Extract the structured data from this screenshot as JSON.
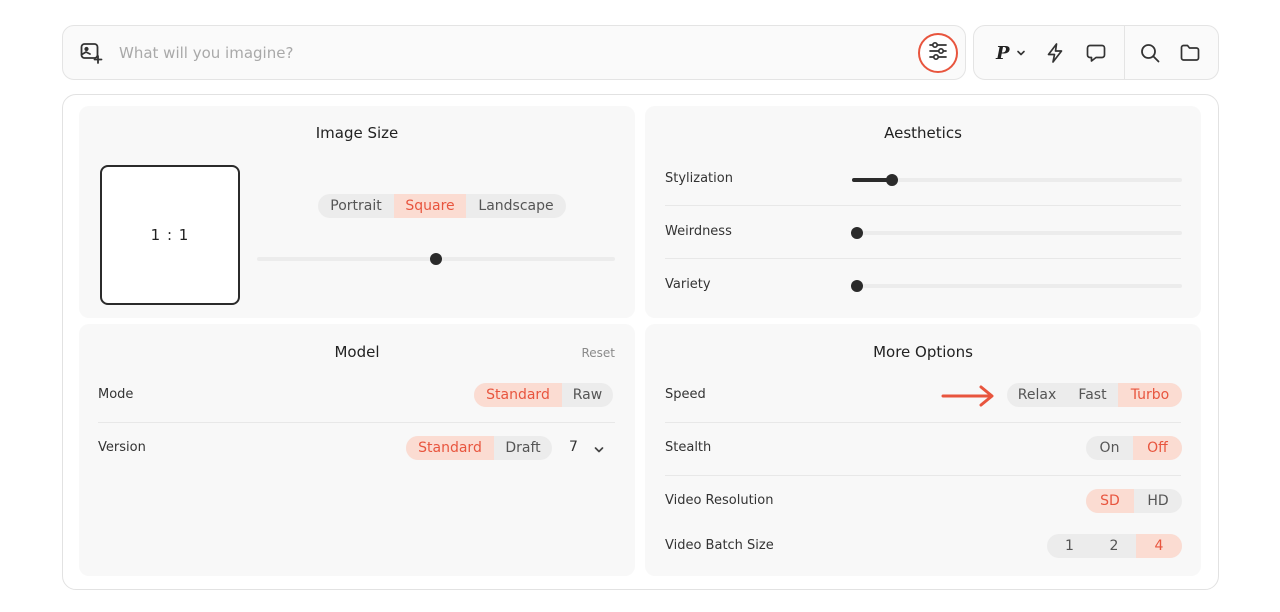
{
  "prompt": {
    "placeholder": "What will you imagine?"
  },
  "toolbar": {
    "personalize_label": "P"
  },
  "image_size": {
    "title": "Image Size",
    "ratio": "1 : 1",
    "orientations": [
      "Portrait",
      "Square",
      "Landscape"
    ],
    "selected": "Square",
    "slider_value": 0.5
  },
  "aesthetics": {
    "title": "Aesthetics",
    "stylization": {
      "label": "Stylization",
      "value": 0.12
    },
    "weirdness": {
      "label": "Weirdness",
      "value": 0
    },
    "variety": {
      "label": "Variety",
      "value": 0
    }
  },
  "model": {
    "title": "Model",
    "reset_label": "Reset",
    "mode": {
      "label": "Mode",
      "options": [
        "Standard",
        "Raw"
      ],
      "selected": "Standard"
    },
    "version": {
      "label": "Version",
      "options": [
        "Standard",
        "Draft"
      ],
      "selected": "Standard",
      "number": "7"
    }
  },
  "more_options": {
    "title": "More Options",
    "speed": {
      "label": "Speed",
      "options": [
        "Relax",
        "Fast",
        "Turbo"
      ],
      "selected": "Turbo"
    },
    "stealth": {
      "label": "Stealth",
      "options": [
        "On",
        "Off"
      ],
      "selected": "Off"
    },
    "video_resolution": {
      "label": "Video Resolution",
      "options": [
        "SD",
        "HD"
      ],
      "selected": "SD"
    },
    "video_batch_size": {
      "label": "Video Batch Size",
      "options": [
        "1",
        "2",
        "4"
      ],
      "selected": "4"
    }
  },
  "colors": {
    "accent": "#e8553e",
    "accent_bg": "#fbdcd2",
    "card_bg": "#f8f8f8"
  },
  "icons": [
    "image-add-icon",
    "sliders-icon",
    "chevron-down-icon",
    "lightning-icon",
    "chat-icon",
    "search-icon",
    "folder-icon",
    "arrow-right-icon"
  ]
}
